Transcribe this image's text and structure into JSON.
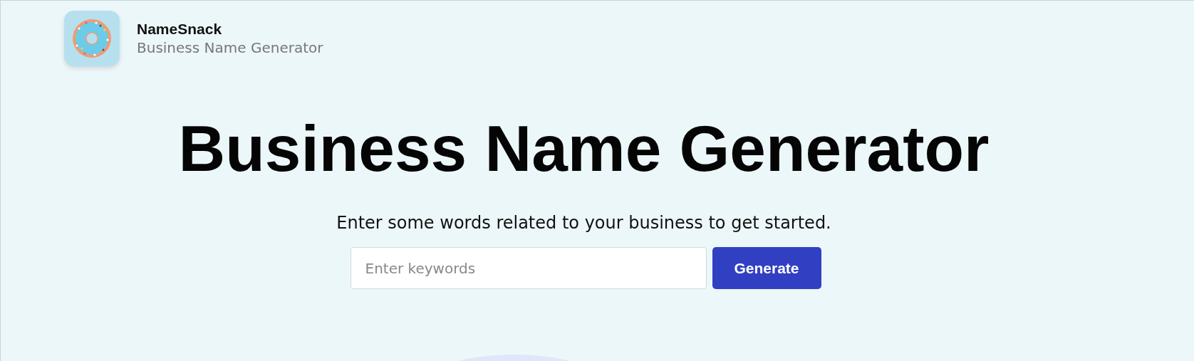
{
  "brand": {
    "name": "NameSnack",
    "tagline": "Business Name Generator"
  },
  "hero": {
    "title": "Business Name Generator",
    "subtitle": "Enter some words related to your business to get started."
  },
  "search": {
    "placeholder": "Enter keywords",
    "button": "Generate"
  }
}
